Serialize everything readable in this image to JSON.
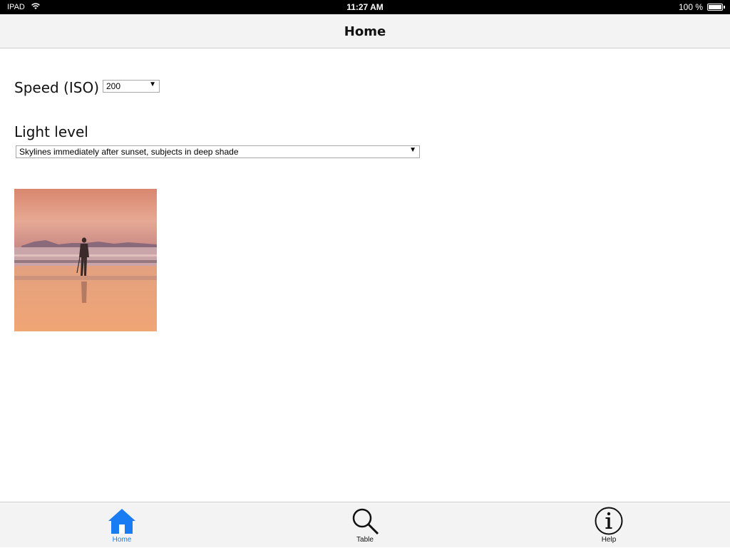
{
  "status_bar": {
    "carrier": "IPAD",
    "time": "11:27 AM",
    "battery_text": "100 %",
    "battery_level": 1.0,
    "wifi_icon": "wifi-icon",
    "battery_icon": "battery-icon"
  },
  "nav": {
    "title": "Home"
  },
  "form": {
    "speed_label": "Speed (ISO)",
    "speed_value": "200",
    "light_label": "Light level",
    "light_value": "Skylines immediately after sunset, subjects in deep shade"
  },
  "photo": {
    "description_icon": "beach-sunset-photo"
  },
  "tabs": [
    {
      "label": "Home",
      "icon": "home-icon",
      "active": true
    },
    {
      "label": "Table",
      "icon": "search-icon",
      "active": false
    },
    {
      "label": "Help",
      "icon": "info-icon",
      "active": false
    }
  ],
  "colors": {
    "accent": "#1a7cf3",
    "status_bar_bg": "#000000",
    "bar_bg": "#f3f3f3"
  }
}
